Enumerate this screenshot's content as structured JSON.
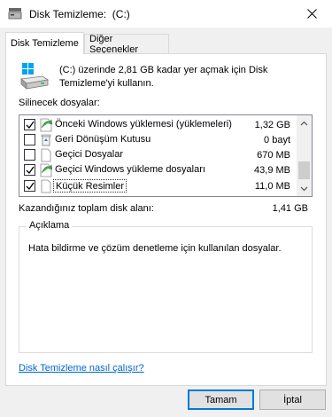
{
  "window": {
    "title": "Disk Temizleme:  (C:)",
    "close_symbol": "✕"
  },
  "tabs": [
    {
      "label": "Disk Temizleme",
      "active": true
    },
    {
      "label": "Diğer Seçenekler",
      "active": false
    }
  ],
  "header": {
    "description": "(C:) üzerinde 2,81 GB kadar yer açmak için Disk Temizleme'yi kullanın."
  },
  "files": {
    "label": "Silinecek dosyalar:",
    "items": [
      {
        "name": "Önceki Windows yüklemesi (yüklemeleri)",
        "size": "1,32 GB",
        "checked": true,
        "icon": "windows-update-icon"
      },
      {
        "name": "Geri Dönüşüm Kutusu",
        "size": "0 bayt",
        "checked": false,
        "icon": "recycle-bin-icon"
      },
      {
        "name": "Geçici Dosyalar",
        "size": "670 MB",
        "checked": false,
        "icon": "file-icon"
      },
      {
        "name": "Geçici Windows yükleme dosyaları",
        "size": "43,9 MB",
        "checked": true,
        "icon": "windows-update-icon"
      },
      {
        "name": "Küçük Resimler",
        "size": "11,0 MB",
        "checked": true,
        "icon": "file-icon"
      }
    ]
  },
  "total": {
    "label": "Kazandığınız toplam disk alanı:",
    "value": "1,41 GB"
  },
  "description_box": {
    "title": "Açıklama",
    "text": "Hata bildirme ve çözüm denetleme için kullanılan dosyalar."
  },
  "help_link": "Disk Temizleme nasıl çalışır?",
  "buttons": {
    "ok": "Tamam",
    "cancel": "İptal"
  },
  "colors": {
    "link": "#0066cc",
    "default_button_border": "#0078d7"
  }
}
